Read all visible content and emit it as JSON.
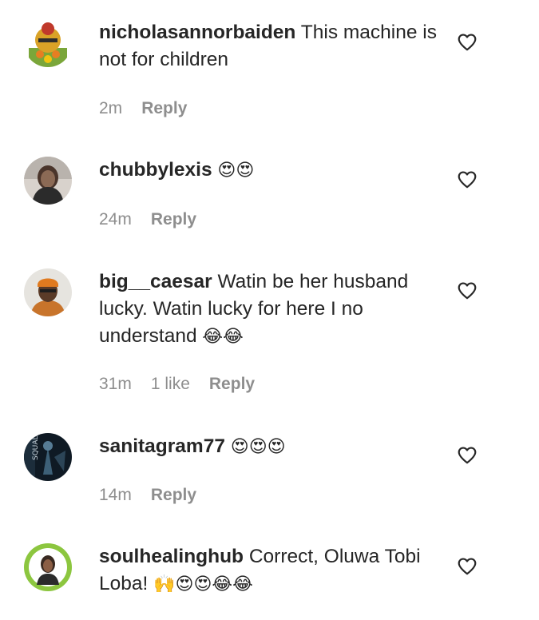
{
  "comments": [
    {
      "username": "nicholasannorbaiden",
      "text": "This machine is not for children",
      "emojis": "",
      "time": "2m",
      "likes": "",
      "reply_label": "Reply",
      "avatar_color": "#d9a227"
    },
    {
      "username": "chubbylexis",
      "text": "",
      "emojis": "😍😍",
      "time": "24m",
      "likes": "",
      "reply_label": "Reply",
      "avatar_color": "#6b5b53"
    },
    {
      "username": "big__caesar",
      "text": "Watin be her husband lucky. Watin lucky for here I no understand",
      "emojis": "😂😂",
      "time": "31m",
      "likes": "1 like",
      "reply_label": "Reply",
      "avatar_color": "#c8742b"
    },
    {
      "username": "sanitagram77",
      "text": "",
      "emojis": "😍😍😍",
      "time": "14m",
      "likes": "",
      "reply_label": "Reply",
      "avatar_color": "#243a4a"
    },
    {
      "username": "soulhealinghub",
      "text": "Correct, Oluwa Tobi Loba!",
      "emojis": "🙌😍😍😂😂",
      "time": "",
      "likes": "",
      "reply_label": "",
      "avatar_color": "#8cc63f"
    }
  ],
  "icons": {
    "like": "heart-outline-icon"
  },
  "colors": {
    "text": "#262626",
    "secondary": "#8e8e8e",
    "background": "#ffffff"
  }
}
